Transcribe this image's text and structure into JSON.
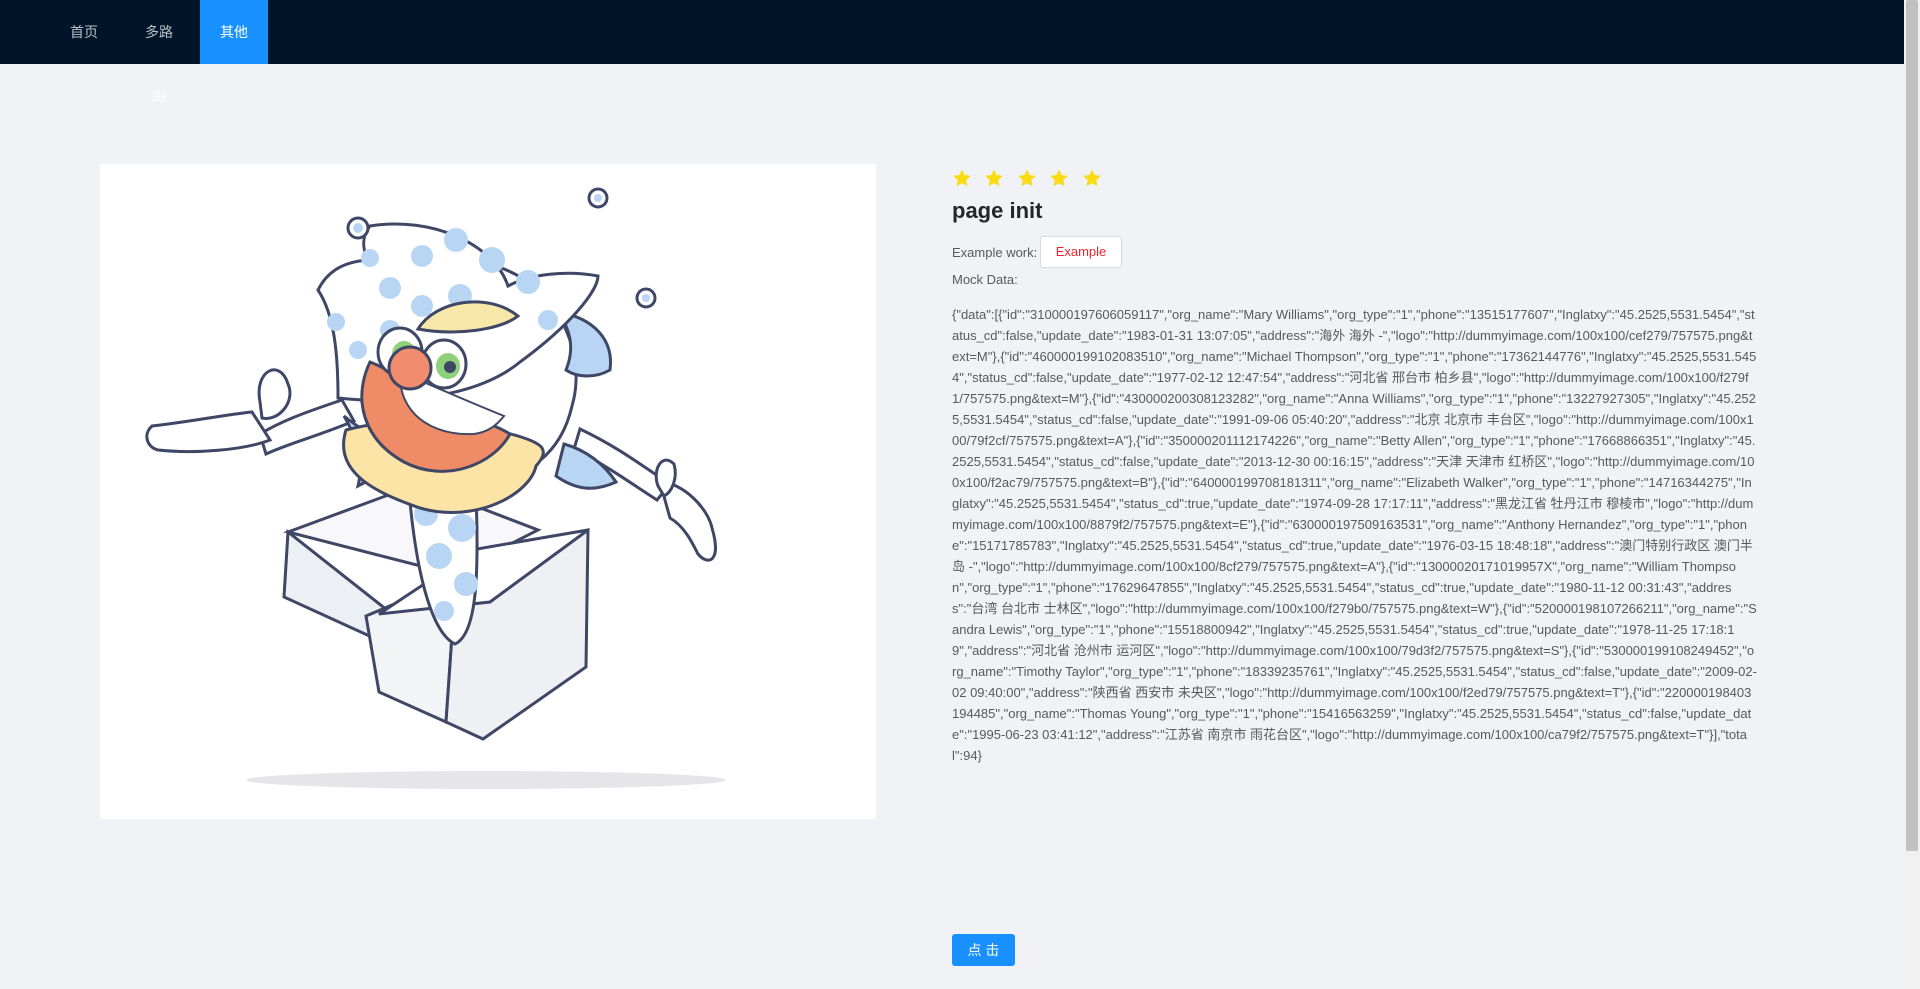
{
  "nav": {
    "items": [
      {
        "label": "首页"
      },
      {
        "label": "多路由"
      },
      {
        "label": "其他"
      }
    ]
  },
  "rating": {
    "value": 5,
    "max": 5,
    "color": "#fadb14"
  },
  "page": {
    "title": "page init",
    "example_label": "Example work:",
    "example_button": "Example",
    "mock_label": "Mock Data:",
    "mock_data": "{\"data\":[{\"id\":\"310000197606059117\",\"org_name\":\"Mary Williams\",\"org_type\":\"1\",\"phone\":\"13515177607\",\"Inglatxy\":\"45.2525,5531.5454\",\"status_cd\":false,\"update_date\":\"1983-01-31 13:07:05\",\"address\":\"海外 海外 -\",\"logo\":\"http://dummyimage.com/100x100/cef279/757575.png&text=M\"},{\"id\":\"460000199102083510\",\"org_name\":\"Michael Thompson\",\"org_type\":\"1\",\"phone\":\"17362144776\",\"Inglatxy\":\"45.2525,5531.5454\",\"status_cd\":false,\"update_date\":\"1977-02-12 12:47:54\",\"address\":\"河北省 邢台市 柏乡县\",\"logo\":\"http://dummyimage.com/100x100/f279f1/757575.png&text=M\"},{\"id\":\"430000200308123282\",\"org_name\":\"Anna Williams\",\"org_type\":\"1\",\"phone\":\"13227927305\",\"Inglatxy\":\"45.2525,5531.5454\",\"status_cd\":false,\"update_date\":\"1991-09-06 05:40:20\",\"address\":\"北京 北京市 丰台区\",\"logo\":\"http://dummyimage.com/100x100/79f2cf/757575.png&text=A\"},{\"id\":\"350000201112174226\",\"org_name\":\"Betty Allen\",\"org_type\":\"1\",\"phone\":\"17668866351\",\"Inglatxy\":\"45.2525,5531.5454\",\"status_cd\":false,\"update_date\":\"2013-12-30 00:16:15\",\"address\":\"天津 天津市 红桥区\",\"logo\":\"http://dummyimage.com/100x100/f2ac79/757575.png&text=B\"},{\"id\":\"640000199708181311\",\"org_name\":\"Elizabeth Walker\",\"org_type\":\"1\",\"phone\":\"14716344275\",\"Inglatxy\":\"45.2525,5531.5454\",\"status_cd\":true,\"update_date\":\"1974-09-28 17:17:11\",\"address\":\"黑龙江省 牡丹江市 穆棱市\",\"logo\":\"http://dummyimage.com/100x100/8879f2/757575.png&text=E\"},{\"id\":\"630000197509163531\",\"org_name\":\"Anthony Hernandez\",\"org_type\":\"1\",\"phone\":\"15171785783\",\"Inglatxy\":\"45.2525,5531.5454\",\"status_cd\":true,\"update_date\":\"1976-03-15 18:48:18\",\"address\":\"澳门特别行政区 澳门半岛 -\",\"logo\":\"http://dummyimage.com/100x100/8cf279/757575.png&text=A\"},{\"id\":\"13000020171019957X\",\"org_name\":\"William Thompson\",\"org_type\":\"1\",\"phone\":\"17629647855\",\"Inglatxy\":\"45.2525,5531.5454\",\"status_cd\":true,\"update_date\":\"1980-11-12 00:31:43\",\"address\":\"台湾 台北市 士林区\",\"logo\":\"http://dummyimage.com/100x100/f279b0/757575.png&text=W\"},{\"id\":\"520000198107266211\",\"org_name\":\"Sandra Lewis\",\"org_type\":\"1\",\"phone\":\"15518800942\",\"Inglatxy\":\"45.2525,5531.5454\",\"status_cd\":true,\"update_date\":\"1978-11-25 17:18:19\",\"address\":\"河北省 沧州市 运河区\",\"logo\":\"http://dummyimage.com/100x100/79d3f2/757575.png&text=S\"},{\"id\":\"530000199108249452\",\"org_name\":\"Timothy Taylor\",\"org_type\":\"1\",\"phone\":\"18339235761\",\"Inglatxy\":\"45.2525,5531.5454\",\"status_cd\":false,\"update_date\":\"2009-02-02 09:40:00\",\"address\":\"陕西省 西安市 未央区\",\"logo\":\"http://dummyimage.com/100x100/f2ed79/757575.png&text=T\"},{\"id\":\"220000198403194485\",\"org_name\":\"Thomas Young\",\"org_type\":\"1\",\"phone\":\"15416563259\",\"Inglatxy\":\"45.2525,5531.5454\",\"status_cd\":false,\"update_date\":\"1995-06-23 03:41:12\",\"address\":\"江苏省 南京市 雨花台区\",\"logo\":\"http://dummyimage.com/100x100/ca79f2/757575.png&text=T\"}],\"total\":94}",
    "primary_button": "点 击"
  },
  "colors": {
    "nav_background": "#001529",
    "nav_active": "#1890ff",
    "page_background": "#f0f2f5",
    "example_button_text": "#f5222d",
    "primary_button": "#1890ff"
  }
}
